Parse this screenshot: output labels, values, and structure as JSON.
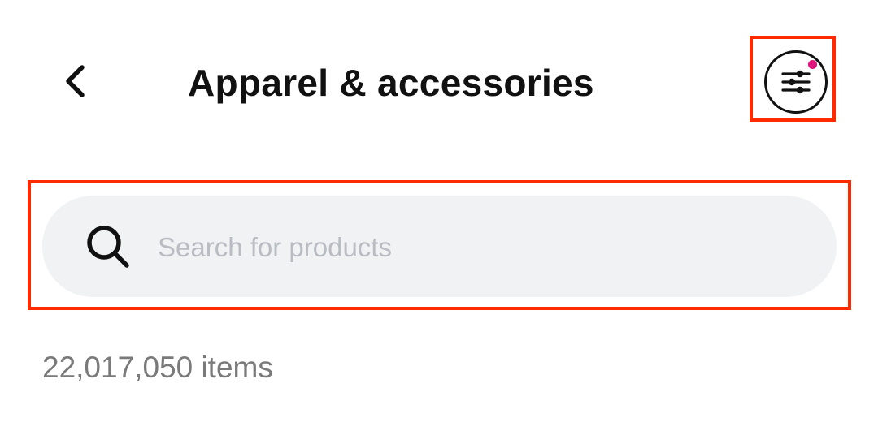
{
  "header": {
    "back_icon": "chevron-left-icon",
    "title": "Apparel & accessories",
    "filter_icon": "sliders-icon",
    "filter_indicator_color": "#e0157d"
  },
  "search": {
    "icon": "search-icon",
    "placeholder": "Search for products",
    "value": ""
  },
  "results": {
    "count_text": "22,017,050 items"
  },
  "colors": {
    "highlight": "#ff2a00",
    "search_bg": "#f1f2f4",
    "title_text": "#111111",
    "count_text": "#7a7a7a",
    "placeholder_text": "#b9bcc2"
  }
}
